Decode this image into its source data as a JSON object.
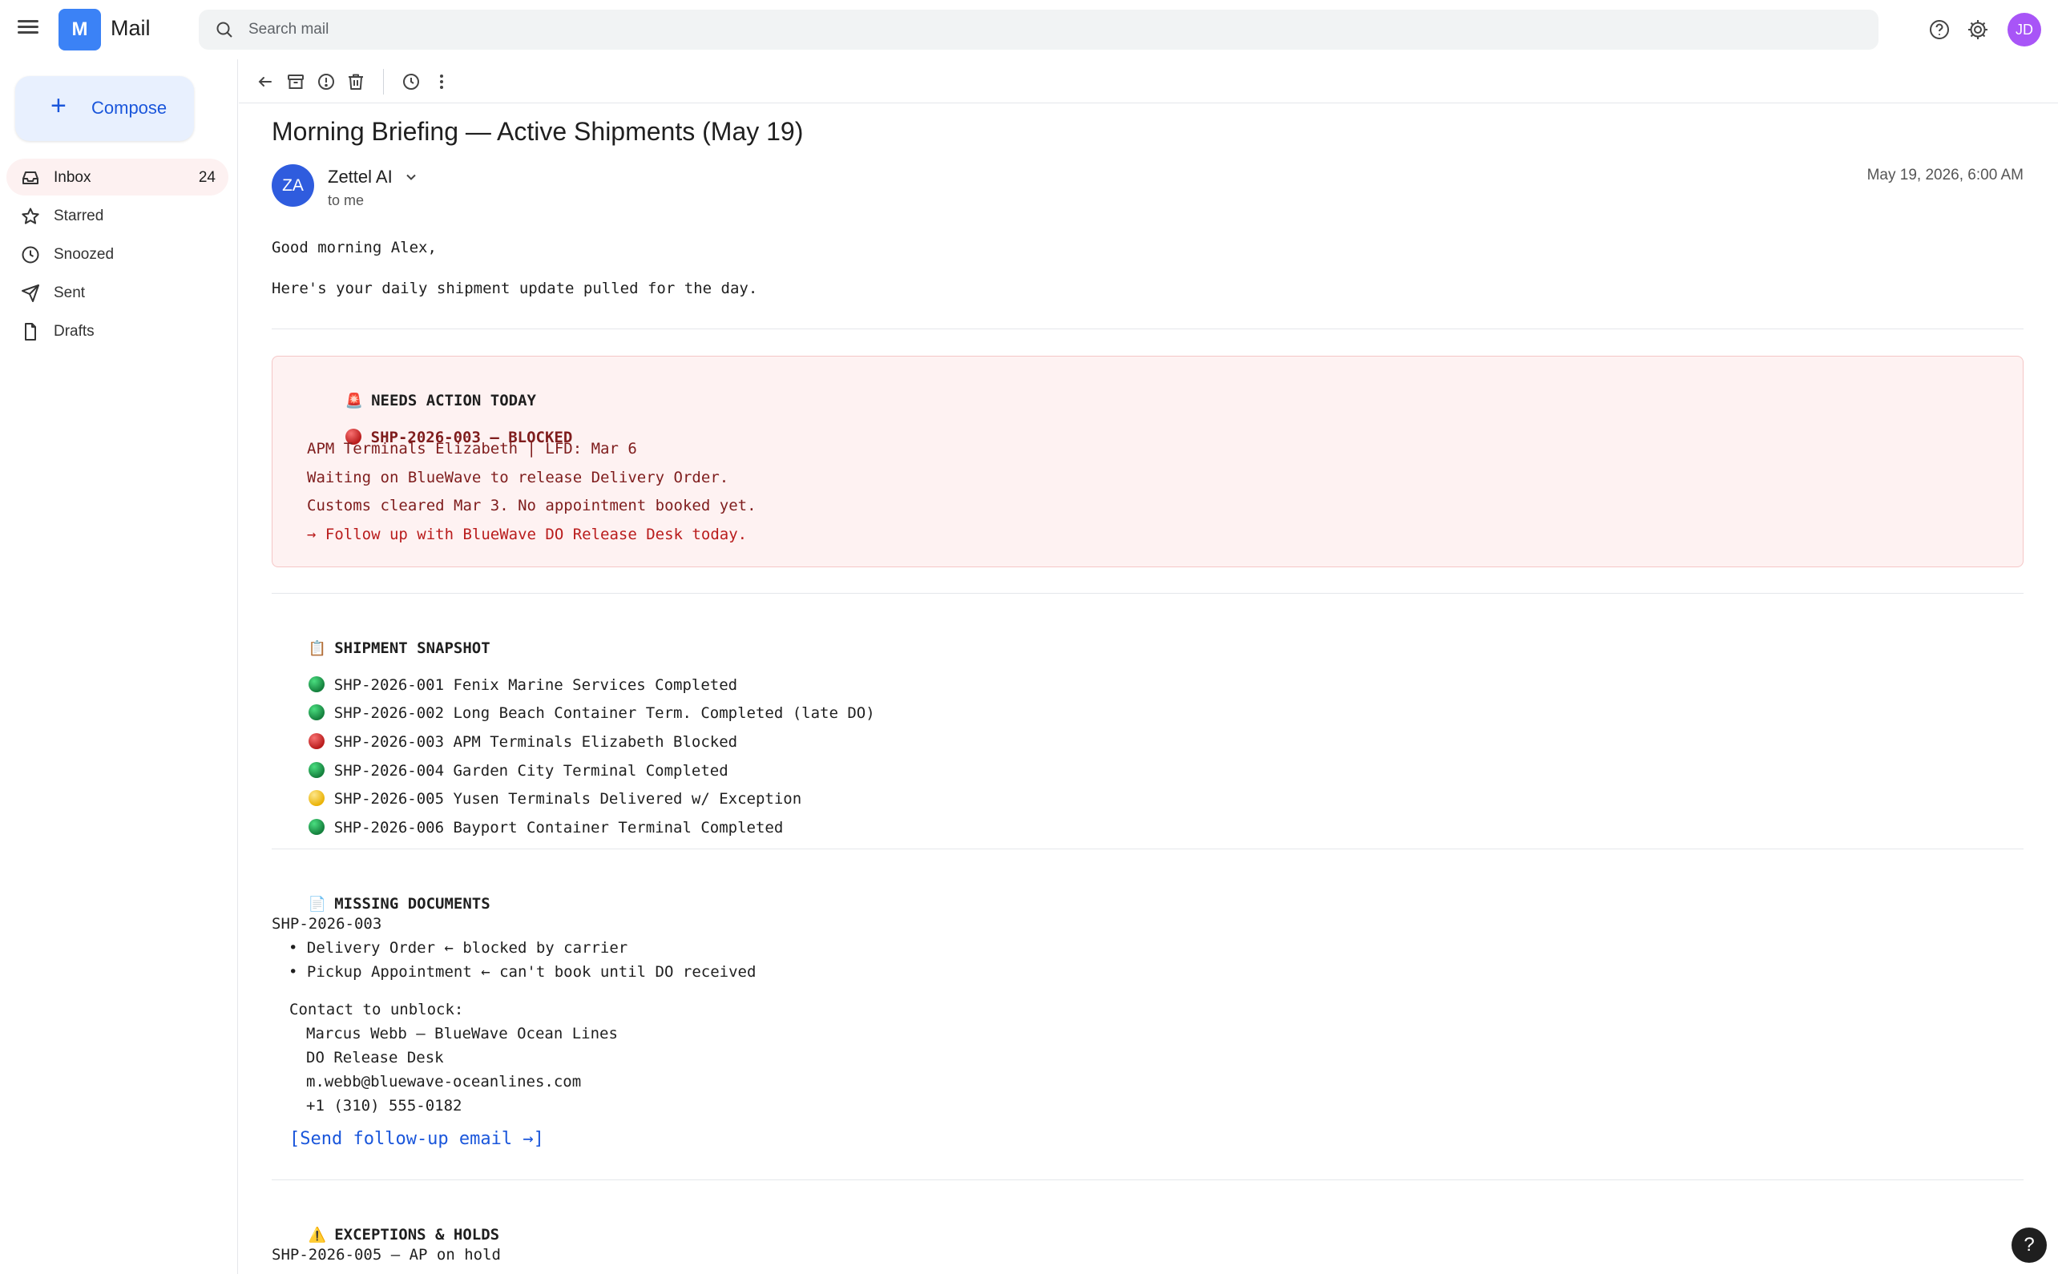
{
  "app": {
    "logo_letter": "M",
    "title": "Mail"
  },
  "search": {
    "placeholder": "Search mail"
  },
  "user": {
    "initials": "JD"
  },
  "sidebar": {
    "compose_label": "Compose",
    "items": [
      {
        "label": "Inbox",
        "count": "24",
        "icon": "inbox-icon"
      },
      {
        "label": "Starred",
        "icon": "star-icon"
      },
      {
        "label": "Snoozed",
        "icon": "clock-icon"
      },
      {
        "label": "Sent",
        "icon": "send-icon"
      },
      {
        "label": "Drafts",
        "icon": "draft-icon"
      }
    ]
  },
  "email": {
    "subject": "Morning Briefing — Active Shipments (May 19)",
    "sender": {
      "initials": "ZA",
      "name": "Zettel AI",
      "to": "to me"
    },
    "date": "May 19, 2026, 6:00 AM",
    "greeting": "Good morning Alex,",
    "intro": "Here's your daily shipment update pulled for the day.",
    "needs_action": {
      "icon": "🚨",
      "heading": "NEEDS ACTION TODAY",
      "item_title": "SHP-2026-003 — BLOCKED",
      "lines": [
        "APM Terminals Elizabeth | LFD: Mar 6",
        "Waiting on BlueWave to release Delivery Order.",
        "Customs cleared Mar 3. No appointment booked yet.",
        "→ Follow up with BlueWave DO Release Desk today."
      ]
    },
    "snapshot": {
      "icon": "📋",
      "heading": "SHIPMENT SNAPSHOT",
      "rows": [
        {
          "status_color": "green",
          "text": "SHP-2026-001 Fenix Marine Services Completed"
        },
        {
          "status_color": "green",
          "text": "SHP-2026-002 Long Beach Container Term. Completed (late DO)"
        },
        {
          "status_color": "red",
          "text": "SHP-2026-003 APM Terminals Elizabeth Blocked"
        },
        {
          "status_color": "green",
          "text": "SHP-2026-004 Garden City Terminal Completed"
        },
        {
          "status_color": "yellow",
          "text": "SHP-2026-005 Yusen Terminals Delivered w/ Exception"
        },
        {
          "status_color": "green",
          "text": "SHP-2026-006 Bayport Container Terminal Completed"
        }
      ]
    },
    "missing_docs": {
      "icon": "📄",
      "heading": "MISSING DOCUMENTS",
      "shipment": "SHP-2026-003",
      "bullets": [
        "• Delivery Order ← blocked by carrier",
        "• Pickup Appointment ← can't book until DO received"
      ],
      "contact_label": "Contact to unblock:",
      "contact_lines": [
        "Marcus Webb — BlueWave Ocean Lines",
        "DO Release Desk",
        "m.webb@bluewave-oceanlines.com",
        "+1 (310) 555-0182"
      ],
      "action_link": "[Send follow-up email →]"
    },
    "exceptions": {
      "icon": "⚠️",
      "heading": "EXCEPTIONS & HOLDS",
      "first_line": "SHP-2026-005 — AP on hold"
    }
  },
  "help_fab": "?"
}
